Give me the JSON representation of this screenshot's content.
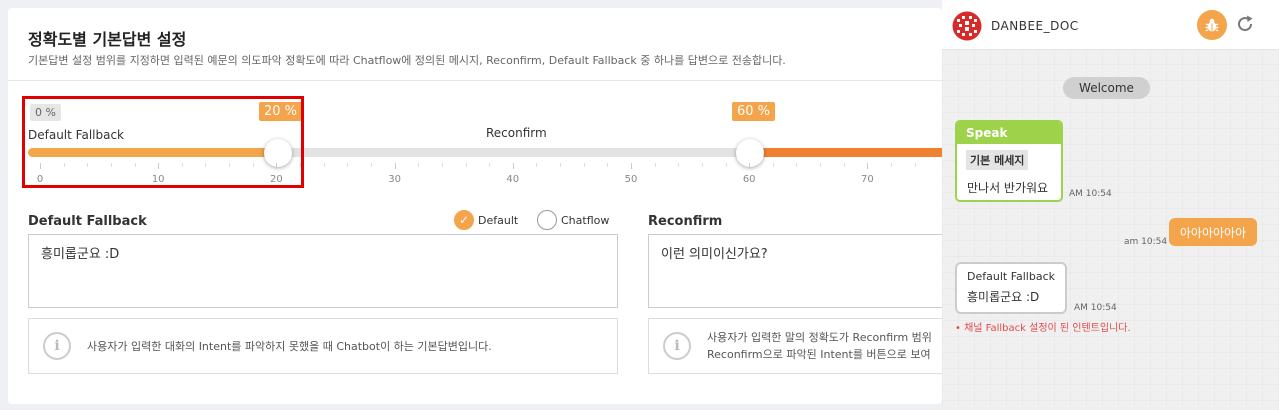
{
  "settings": {
    "title": "정확도별 기본답변 설정",
    "description": "기본답변 설정 범위를 지정하면 입력된 예문의 의도파악 정확도에 따라 Chatflow에 정의된 메시지, Reconfirm, Default Fallback 중 하나를 답변으로 전송합니다.",
    "slider": {
      "min_badge": "0 %",
      "fallback_badge": "20 %",
      "reconfirm_badge": "60 %",
      "fallback_threshold": 20,
      "reconfirm_threshold": 60,
      "range_label_fallback": "Default Fallback",
      "range_label_reconfirm": "Reconfirm",
      "ticks": [
        "0",
        "10",
        "20",
        "30",
        "40",
        "50",
        "60",
        "70"
      ]
    },
    "fallback": {
      "label": "Default Fallback",
      "radio_default": "Default",
      "radio_chatflow": "Chatflow",
      "selected": "Default",
      "text": "흥미롭군요 :D",
      "info_text": "사용자가 입력한 대화의 Intent를 파악하지 못했을 때 Chatbot이 하는 기본답변입니다."
    },
    "reconfirm": {
      "label": "Reconfirm",
      "text": "이런 의미이신가요?",
      "info_line1": "사용자가 입력한 말의 정확도가 Reconfirm 범위",
      "info_line2": "Reconfirm으로 파악된 Intent를 버튼으로 보여"
    }
  },
  "chat": {
    "bot_name": "DANBEE_DOC",
    "welcome": "Welcome",
    "speak_header": "Speak",
    "speak_tag": "기본 메세지",
    "speak_message": "만나서 반가워요",
    "speak_time": "AM 10:54",
    "user_message": "아아아아아아",
    "user_time": "am 10:54",
    "fallback_title": "Default Fallback",
    "fallback_message": "흥미롭군요 :D",
    "fallback_time": "AM 10:54",
    "notice": "• 채널 Fallback 설정이 된 인텐트입니다."
  },
  "colors": {
    "accent": "#f4a44a",
    "accent_dark": "#f08130",
    "speak_green": "#9ed24a",
    "highlight_red": "#e00000",
    "notice_red": "#e24b4b"
  },
  "icons": [
    "danbee-logo-icon",
    "bug-icon",
    "refresh-icon",
    "info-icon",
    "check-icon"
  ]
}
